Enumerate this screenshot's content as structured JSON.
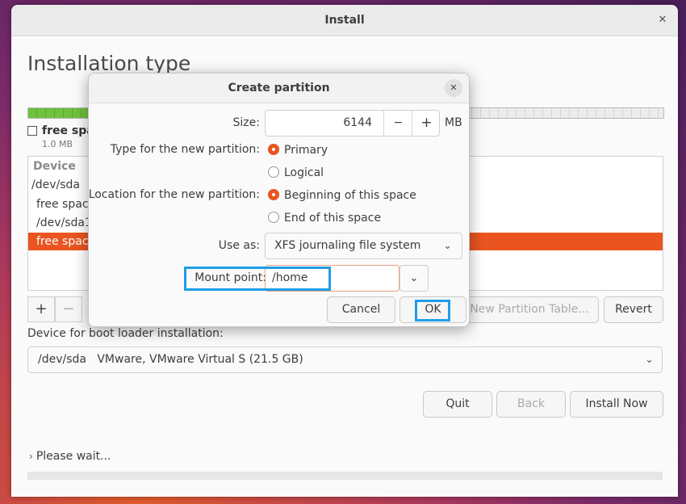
{
  "window": {
    "title": "Install",
    "close_icon": "close-icon"
  },
  "page": {
    "heading": "Installation type"
  },
  "legend": {
    "name": "free spa",
    "size": "1.0 MB"
  },
  "table": {
    "header": "Device",
    "rows": [
      "/dev/sda",
      "free space",
      "/dev/sda1",
      "free space"
    ],
    "selected_index": 3
  },
  "partition_buttons": {
    "add": "+",
    "remove": "−"
  },
  "buttons": {
    "new_partition_table": "New Partition Table...",
    "revert": "Revert",
    "quit": "Quit",
    "back": "Back",
    "install_now": "Install Now"
  },
  "boot_loader": {
    "label": "Device for boot loader installation:",
    "device": "/dev/sda",
    "description": "VMware, VMware Virtual S (21.5 GB)"
  },
  "status": {
    "text": "Please wait..."
  },
  "dialog": {
    "title": "Create partition",
    "size_label": "Size:",
    "size_value": "6144",
    "size_unit": "MB",
    "minus": "−",
    "plus": "+",
    "type_label": "Type for the new partition:",
    "type_options": [
      "Primary",
      "Logical"
    ],
    "type_selected": "Primary",
    "location_label": "Location for the new partition:",
    "location_options": [
      "Beginning of this space",
      "End of this space"
    ],
    "location_selected": "Beginning of this space",
    "use_as_label": "Use as:",
    "use_as_value": "XFS journaling file system",
    "mount_label": "Mount point:",
    "mount_value": "/home",
    "cancel": "Cancel",
    "ok": "OK"
  },
  "colors": {
    "accent": "#e95420",
    "highlight": "#1e9ee8",
    "used_space": "#6fc23f"
  }
}
